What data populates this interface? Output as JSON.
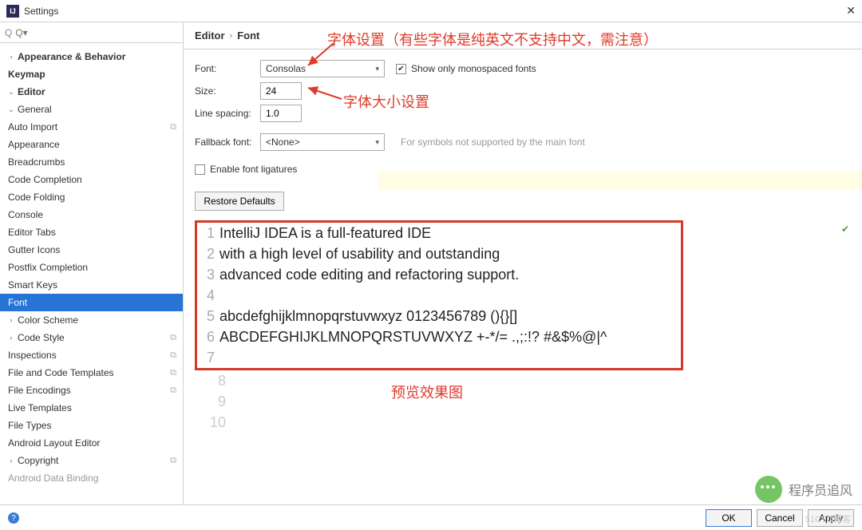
{
  "window": {
    "title": "Settings",
    "close": "✕"
  },
  "search": {
    "placeholder": "Q▾"
  },
  "tree": {
    "appearance": "Appearance & Behavior",
    "keymap": "Keymap",
    "editor": "Editor",
    "general": "General",
    "auto_import": "Auto Import",
    "appearance2": "Appearance",
    "breadcrumbs": "Breadcrumbs",
    "code_completion": "Code Completion",
    "code_folding": "Code Folding",
    "console": "Console",
    "editor_tabs": "Editor Tabs",
    "gutter_icons": "Gutter Icons",
    "postfix": "Postfix Completion",
    "smart_keys": "Smart Keys",
    "font": "Font",
    "color_scheme": "Color Scheme",
    "code_style": "Code Style",
    "inspections": "Inspections",
    "file_templates": "File and Code Templates",
    "file_encodings": "File Encodings",
    "live_templates": "Live Templates",
    "file_types": "File Types",
    "android_layout": "Android Layout Editor",
    "copyright": "Copyright",
    "android_data": "Android Data Binding"
  },
  "breadcrumb": {
    "root": "Editor",
    "leaf": "Font"
  },
  "form": {
    "font_label": "Font:",
    "font_value": "Consolas",
    "show_mono": "Show only monospaced fonts",
    "size_label": "Size:",
    "size_value": "24",
    "spacing_label": "Line spacing:",
    "spacing_value": "1.0",
    "fallback_label": "Fallback font:",
    "fallback_value": "<None>",
    "fallback_hint": "For symbols not supported by the main font",
    "ligatures": "Enable font ligatures",
    "restore": "Restore Defaults"
  },
  "preview": {
    "l1": "IntelliJ IDEA is a full-featured IDE",
    "l2": "with a high level of usability and outstanding",
    "l3": "advanced code editing and refactoring support.",
    "l4": "",
    "l5": "abcdefghijklmnopqrstuvwxyz 0123456789 (){}[]",
    "l6": "ABCDEFGHIJKLMNOPQRSTUVWXYZ +-*/= .,;:!? #&$%@|^",
    "l7": ""
  },
  "annotations": {
    "a1": "字体设置（有些字体是纯英文不支持中文，需注意）",
    "a2": "字体大小设置",
    "a3": "预览效果图"
  },
  "footer": {
    "ok": "OK",
    "cancel": "Cancel",
    "apply": "Apply"
  },
  "watermark": {
    "text": "程序员追风",
    "sub": "51CTO博客"
  }
}
